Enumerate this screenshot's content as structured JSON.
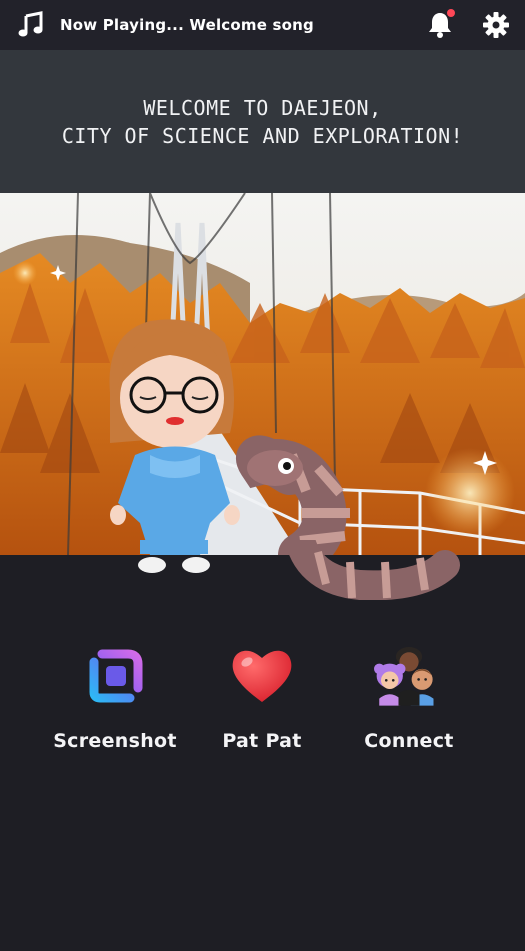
{
  "header": {
    "now_playing": "Now Playing... Welcome song",
    "icons": [
      "music-note-icon",
      "bell-icon",
      "gear-icon"
    ],
    "notification_dot_color": "#ff4757"
  },
  "banner": {
    "line1": "WELCOME TO DAEJEON,",
    "line2": "CITY OF SCIENCE AND EXPLORATION!"
  },
  "actions": [
    {
      "label": "Screenshot",
      "icon": "screenshot-icon"
    },
    {
      "label": "Pat Pat",
      "icon": "heart-icon"
    },
    {
      "label": "Connect",
      "icon": "people-icon"
    }
  ],
  "colors": {
    "background": "#1e1e24",
    "topbar": "#22222a",
    "banner": "#33373d"
  }
}
